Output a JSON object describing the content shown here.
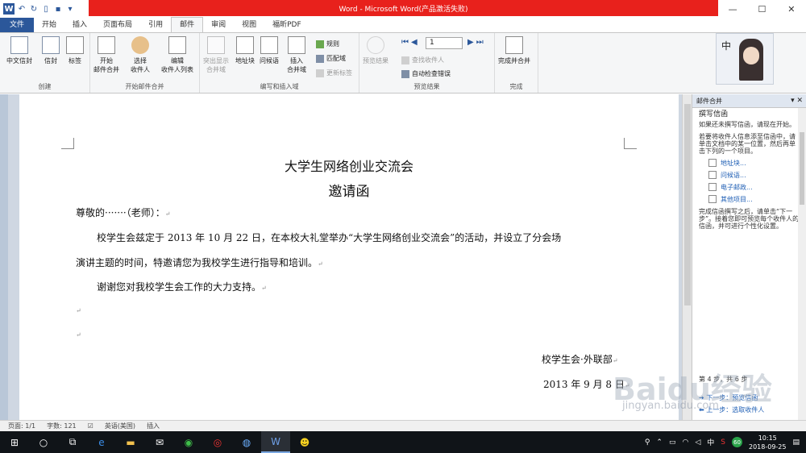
{
  "window": {
    "title": "Word - Microsoft Word(产品激活失败)",
    "minimize": "—",
    "maximize": "☐",
    "close": "✕"
  },
  "tabs": [
    "文件",
    "开始",
    "插入",
    "页面布局",
    "引用",
    "邮件",
    "审阅",
    "视图",
    "福昕PDF"
  ],
  "ribbon": {
    "create": {
      "label": "创建",
      "btn1": "中文信封",
      "btn2": "信封",
      "btn3": "标签"
    },
    "start_merge": {
      "label": "开始邮件合并",
      "btn1a": "开始",
      "btn1b": "邮件合并",
      "btn2a": "选择",
      "btn2b": "收件人",
      "btn3a": "编辑",
      "btn3b": "收件人列表"
    },
    "write_insert": {
      "label": "编写和插入域",
      "btn1a": "突出显示",
      "btn1b": "合并域",
      "btn2": "地址块",
      "btn3": "问候语",
      "btn4a": "插入",
      "btn4b": "合并域",
      "small1": "规则",
      "small2": "匹配域",
      "small3": "更新标签"
    },
    "preview": {
      "label": "预览结果",
      "btn1": "预览结果",
      "record": "1",
      "small1": "查找收件人",
      "small2": "自动检查错误"
    },
    "finish": {
      "label": "完成",
      "btn1": "完成并合并"
    },
    "avatar_text": "中"
  },
  "document": {
    "title1": "大学生网络创业交流会",
    "title2": "邀请函",
    "salutation": "尊敬的·······（老师）：",
    "para1_line1": "校学生会兹定于 2013 年 10 月 22 日，在本校大礼堂举办“大学生网络创业交流会”的活动，并设立了分会场",
    "para1_line2": "演讲主题的时间，特邀请您为我校学生进行指导和培训。",
    "para2": "谢谢您对我校学生会工作的大力支持。",
    "signature": "校学生会·外联部",
    "date": "2013 年 9 月 8 日"
  },
  "pane": {
    "title": "邮件合并",
    "section": "撰写信函",
    "text1": "如果还未撰写信函，请现在开始。",
    "text2": "若要将收件人信息添至信函中，请单击文档中的某一位置，然后再单击下列的一个项目。",
    "link1": "地址块...",
    "link2": "问候语...",
    "link3": "电子邮政...",
    "link4": "其他项目...",
    "text3": "完成信函撰写之后，请单击“下一步”。接着您即可预览每个收件人的信函，并可进行个性化设置。",
    "step": "第 4 步，共 6 步",
    "next": "下一步：预览信函",
    "prev": "上一步：选取收件人"
  },
  "statusbar": {
    "page": "页面: 1/1",
    "words": "字数: 121",
    "lang": "英语(美国)",
    "mode": "插入"
  },
  "taskbar": {
    "time": "10:15",
    "date": "2018-09-25",
    "ime": "中",
    "badge": "60"
  },
  "watermark": {
    "brand": "Baidu经验",
    "site": "jingyan.baidu.com"
  }
}
